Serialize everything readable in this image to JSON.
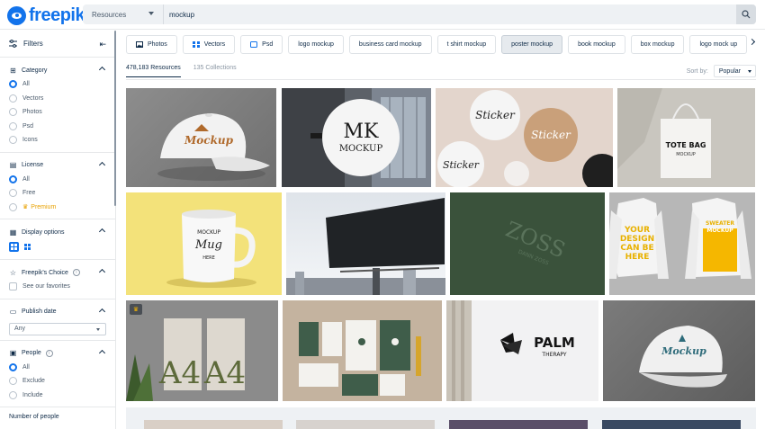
{
  "header": {
    "logo": "freepik",
    "resource_select": "Resources",
    "search_value": "mockup"
  },
  "sidebar": {
    "title": "Filters",
    "category": {
      "title": "Category",
      "options": [
        "All",
        "Vectors",
        "Photos",
        "Psd",
        "Icons"
      ],
      "selected": "All"
    },
    "license": {
      "title": "License",
      "options": [
        "All",
        "Free",
        "Premium"
      ],
      "selected": "All"
    },
    "display": {
      "title": "Display options"
    },
    "freepik_choice": {
      "title": "Freepik's Choice",
      "option": "See our favorites"
    },
    "publish_date": {
      "title": "Publish date",
      "value": "Any"
    },
    "people": {
      "title": "People",
      "options": [
        "All",
        "Exclude",
        "Include"
      ],
      "selected": "All"
    },
    "number_of_people": "Number of people"
  },
  "chips": [
    {
      "label": "Photos",
      "icon": "photo-icon"
    },
    {
      "label": "Vectors",
      "icon": "vector-icon"
    },
    {
      "label": "Psd",
      "icon": "psd-icon"
    },
    {
      "label": "logo mockup"
    },
    {
      "label": "business card mockup"
    },
    {
      "label": "t shirt mockup"
    },
    {
      "label": "poster mockup",
      "active": true
    },
    {
      "label": "book mockup"
    },
    {
      "label": "box mockup"
    },
    {
      "label": "logo mock up"
    }
  ],
  "tabs": {
    "resources": "478,183 Resources",
    "collections": "135 Collections"
  },
  "sort": {
    "label": "Sort by:",
    "value": "Popular"
  },
  "images": {
    "cap_text_1": "Mockup",
    "mk_text_1": "MK",
    "mk_text_2": "MOCKUP",
    "sticker": "Sticker",
    "tote_1": "TOTE BAG",
    "tote_2": "MOCKUP",
    "mug_1": "MOCKUP",
    "mug_2": "Mug",
    "mug_3": "HERE",
    "zoss_1": "ZOSS",
    "zoss_2": "DANN ZOSS",
    "sweat_1": "YOUR DESIGN CAN BE HERE",
    "sweat_2": "SWEATER MOCKUP",
    "a4": "A4",
    "palm_1": "PALM",
    "palm_2": "THERAPY",
    "cap_text_2": "Mockup"
  },
  "colors": {
    "brand": "#1273eb",
    "premium": "#e8a100"
  }
}
